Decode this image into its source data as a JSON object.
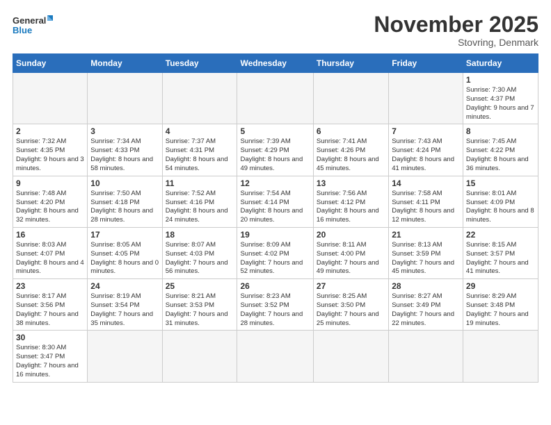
{
  "logo": {
    "text_general": "General",
    "text_blue": "Blue"
  },
  "header": {
    "month_title": "November 2025",
    "location": "Stovring, Denmark"
  },
  "weekdays": [
    "Sunday",
    "Monday",
    "Tuesday",
    "Wednesday",
    "Thursday",
    "Friday",
    "Saturday"
  ],
  "weeks": [
    [
      {
        "day": "",
        "info": ""
      },
      {
        "day": "",
        "info": ""
      },
      {
        "day": "",
        "info": ""
      },
      {
        "day": "",
        "info": ""
      },
      {
        "day": "",
        "info": ""
      },
      {
        "day": "",
        "info": ""
      },
      {
        "day": "1",
        "info": "Sunrise: 7:30 AM\nSunset: 4:37 PM\nDaylight: 9 hours and 7 minutes."
      }
    ],
    [
      {
        "day": "2",
        "info": "Sunrise: 7:32 AM\nSunset: 4:35 PM\nDaylight: 9 hours and 3 minutes."
      },
      {
        "day": "3",
        "info": "Sunrise: 7:34 AM\nSunset: 4:33 PM\nDaylight: 8 hours and 58 minutes."
      },
      {
        "day": "4",
        "info": "Sunrise: 7:37 AM\nSunset: 4:31 PM\nDaylight: 8 hours and 54 minutes."
      },
      {
        "day": "5",
        "info": "Sunrise: 7:39 AM\nSunset: 4:29 PM\nDaylight: 8 hours and 49 minutes."
      },
      {
        "day": "6",
        "info": "Sunrise: 7:41 AM\nSunset: 4:26 PM\nDaylight: 8 hours and 45 minutes."
      },
      {
        "day": "7",
        "info": "Sunrise: 7:43 AM\nSunset: 4:24 PM\nDaylight: 8 hours and 41 minutes."
      },
      {
        "day": "8",
        "info": "Sunrise: 7:45 AM\nSunset: 4:22 PM\nDaylight: 8 hours and 36 minutes."
      }
    ],
    [
      {
        "day": "9",
        "info": "Sunrise: 7:48 AM\nSunset: 4:20 PM\nDaylight: 8 hours and 32 minutes."
      },
      {
        "day": "10",
        "info": "Sunrise: 7:50 AM\nSunset: 4:18 PM\nDaylight: 8 hours and 28 minutes."
      },
      {
        "day": "11",
        "info": "Sunrise: 7:52 AM\nSunset: 4:16 PM\nDaylight: 8 hours and 24 minutes."
      },
      {
        "day": "12",
        "info": "Sunrise: 7:54 AM\nSunset: 4:14 PM\nDaylight: 8 hours and 20 minutes."
      },
      {
        "day": "13",
        "info": "Sunrise: 7:56 AM\nSunset: 4:12 PM\nDaylight: 8 hours and 16 minutes."
      },
      {
        "day": "14",
        "info": "Sunrise: 7:58 AM\nSunset: 4:11 PM\nDaylight: 8 hours and 12 minutes."
      },
      {
        "day": "15",
        "info": "Sunrise: 8:01 AM\nSunset: 4:09 PM\nDaylight: 8 hours and 8 minutes."
      }
    ],
    [
      {
        "day": "16",
        "info": "Sunrise: 8:03 AM\nSunset: 4:07 PM\nDaylight: 8 hours and 4 minutes."
      },
      {
        "day": "17",
        "info": "Sunrise: 8:05 AM\nSunset: 4:05 PM\nDaylight: 8 hours and 0 minutes."
      },
      {
        "day": "18",
        "info": "Sunrise: 8:07 AM\nSunset: 4:03 PM\nDaylight: 7 hours and 56 minutes."
      },
      {
        "day": "19",
        "info": "Sunrise: 8:09 AM\nSunset: 4:02 PM\nDaylight: 7 hours and 52 minutes."
      },
      {
        "day": "20",
        "info": "Sunrise: 8:11 AM\nSunset: 4:00 PM\nDaylight: 7 hours and 49 minutes."
      },
      {
        "day": "21",
        "info": "Sunrise: 8:13 AM\nSunset: 3:59 PM\nDaylight: 7 hours and 45 minutes."
      },
      {
        "day": "22",
        "info": "Sunrise: 8:15 AM\nSunset: 3:57 PM\nDaylight: 7 hours and 41 minutes."
      }
    ],
    [
      {
        "day": "23",
        "info": "Sunrise: 8:17 AM\nSunset: 3:56 PM\nDaylight: 7 hours and 38 minutes."
      },
      {
        "day": "24",
        "info": "Sunrise: 8:19 AM\nSunset: 3:54 PM\nDaylight: 7 hours and 35 minutes."
      },
      {
        "day": "25",
        "info": "Sunrise: 8:21 AM\nSunset: 3:53 PM\nDaylight: 7 hours and 31 minutes."
      },
      {
        "day": "26",
        "info": "Sunrise: 8:23 AM\nSunset: 3:52 PM\nDaylight: 7 hours and 28 minutes."
      },
      {
        "day": "27",
        "info": "Sunrise: 8:25 AM\nSunset: 3:50 PM\nDaylight: 7 hours and 25 minutes."
      },
      {
        "day": "28",
        "info": "Sunrise: 8:27 AM\nSunset: 3:49 PM\nDaylight: 7 hours and 22 minutes."
      },
      {
        "day": "29",
        "info": "Sunrise: 8:29 AM\nSunset: 3:48 PM\nDaylight: 7 hours and 19 minutes."
      }
    ],
    [
      {
        "day": "30",
        "info": "Sunrise: 8:30 AM\nSunset: 3:47 PM\nDaylight: 7 hours and 16 minutes."
      },
      {
        "day": "",
        "info": ""
      },
      {
        "day": "",
        "info": ""
      },
      {
        "day": "",
        "info": ""
      },
      {
        "day": "",
        "info": ""
      },
      {
        "day": "",
        "info": ""
      },
      {
        "day": "",
        "info": ""
      }
    ]
  ]
}
